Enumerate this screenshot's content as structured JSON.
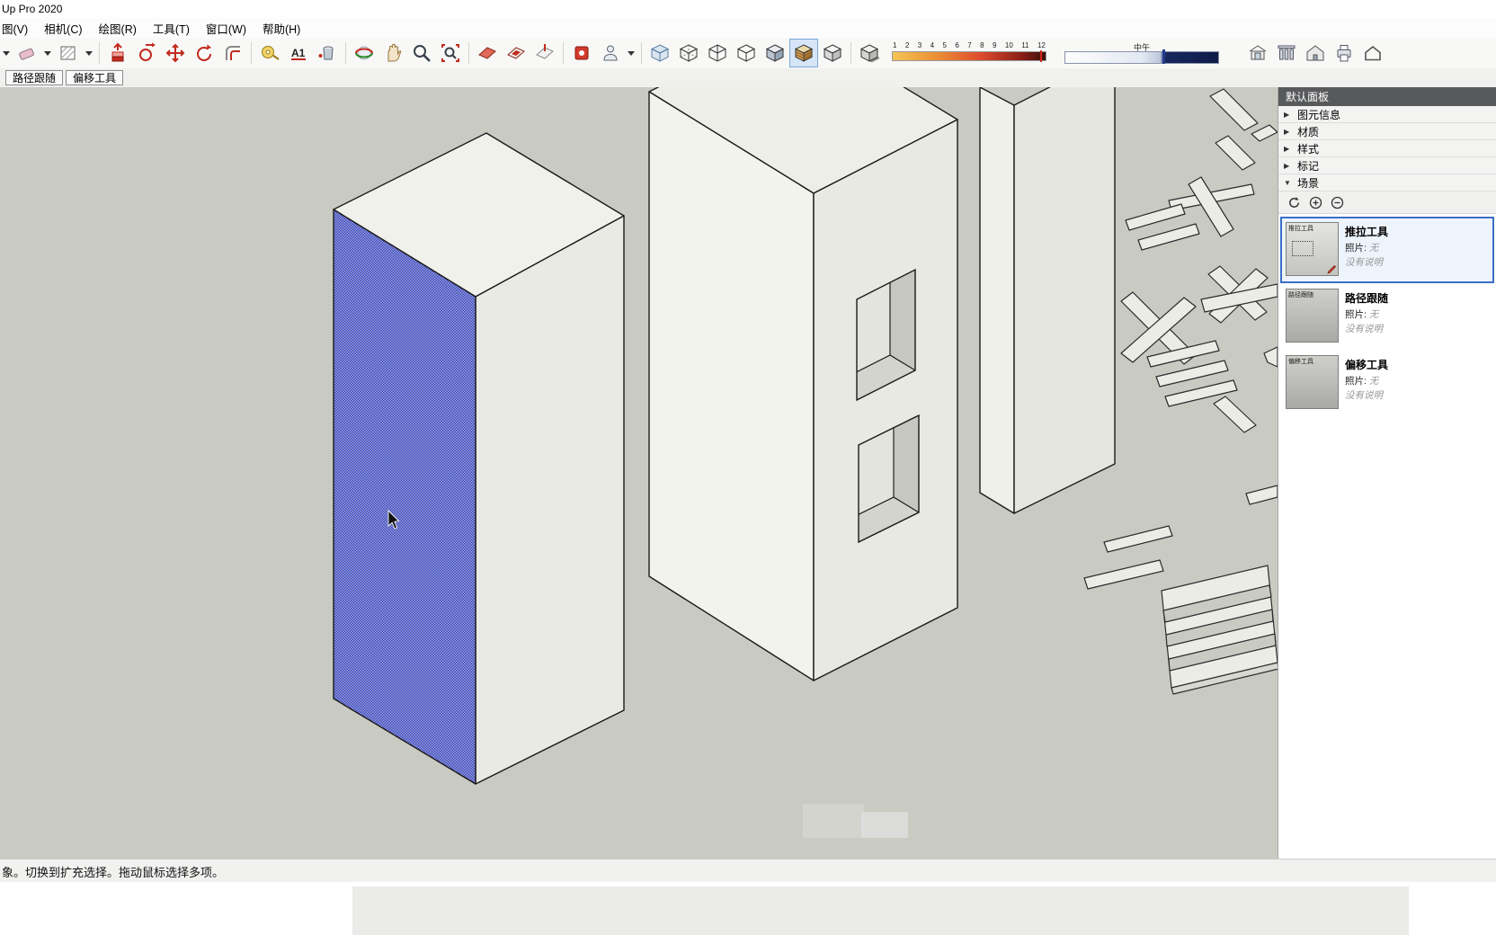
{
  "window": {
    "title": "Up Pro 2020"
  },
  "menubar": {
    "items": [
      {
        "label": "图(V)"
      },
      {
        "label": "相机(C)"
      },
      {
        "label": "绘图(R)"
      },
      {
        "label": "工具(T)"
      },
      {
        "label": "窗口(W)"
      },
      {
        "label": "帮助(H)"
      }
    ]
  },
  "toolbar": {
    "text_tool_glyph": "A1",
    "shadow_dates": [
      "1",
      "2",
      "3",
      "4",
      "5",
      "6",
      "7",
      "8",
      "9",
      "10",
      "11",
      "12"
    ],
    "time_of_day_label": "中午",
    "icon_names": [
      "select-dropdown",
      "eraser",
      "paint-swatch",
      "pushpull",
      "followme",
      "move",
      "rotate",
      "offset",
      "tape-measure",
      "text",
      "paint-bucket",
      "orbit",
      "pan",
      "zoom",
      "zoom-extents",
      "section-plane",
      "section-cut",
      "section-fill",
      "add-location",
      "walk-figure",
      "xray-style",
      "back-edges-style",
      "wireframe-style",
      "hidden-line-style",
      "shaded-style",
      "textured-style",
      "monochrome-style",
      "shadows-toggle",
      "shadow-date-slider",
      "shadow-time-slider",
      "warehouse",
      "components",
      "home",
      "print",
      "house"
    ]
  },
  "tool_tabs": {
    "items": [
      {
        "label": "路径跟随"
      },
      {
        "label": "偏移工具"
      }
    ]
  },
  "panel": {
    "title": "默认面板",
    "sections": [
      {
        "arrow": "▶",
        "label": "图元信息"
      },
      {
        "arrow": "▶",
        "label": "材质"
      },
      {
        "arrow": "▶",
        "label": "样式"
      },
      {
        "arrow": "▶",
        "label": "标记"
      },
      {
        "arrow": "▼",
        "label": "场景"
      }
    ],
    "scenes": {
      "toolbar_icon_names": [
        "refresh-scenes",
        "add-scene",
        "remove-scene"
      ],
      "items": [
        {
          "label": "推拉工具",
          "photo_label": "照片:",
          "photo_value": "无",
          "note": "没有说明",
          "thumb_label": "推拉工具"
        },
        {
          "label": "路径跟随",
          "photo_label": "照片:",
          "photo_value": "无",
          "note": "没有说明",
          "thumb_label": "路径跟随"
        },
        {
          "label": "偏移工具",
          "photo_label": "照片:",
          "photo_value": "无",
          "note": "没有说明",
          "thumb_label": "偏移工具"
        }
      ]
    }
  },
  "statusbar": {
    "message": "象。切换到扩充选择。拖动鼠标选择多项。"
  },
  "colors": {
    "selection_blue": "#3f4bc2",
    "viewport_bg": "#c9cac2",
    "scene_selected_border": "#3a6ec8"
  }
}
